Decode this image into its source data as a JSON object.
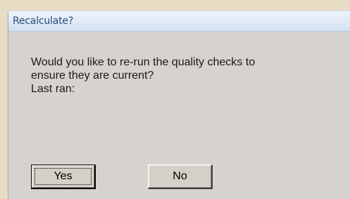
{
  "dialog": {
    "title": "Recalculate?",
    "message_lines": [
      "Would you like to re-run the quality checks to",
      "ensure they are current?",
      "Last ran:"
    ],
    "buttons": {
      "yes_label": "Yes",
      "no_label": "No"
    }
  },
  "colors": {
    "background": "#e9dcc5",
    "dialog_body": "#d6d3ce",
    "title_text": "#2a4a7c"
  }
}
